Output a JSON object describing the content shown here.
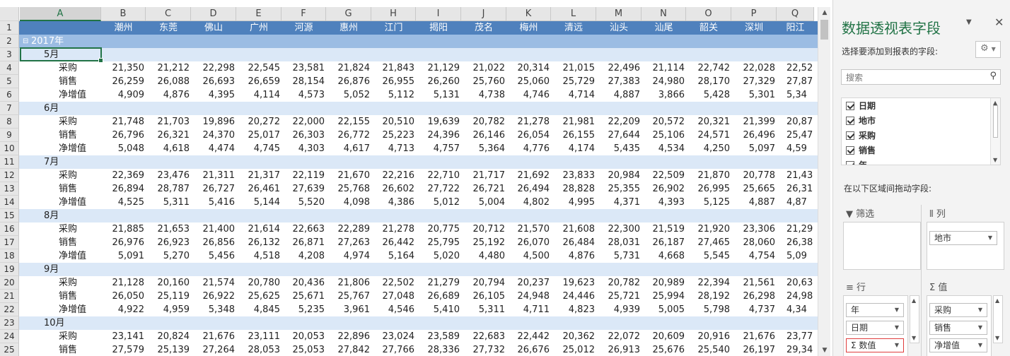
{
  "column_headers": [
    "A",
    "B",
    "C",
    "D",
    "E",
    "F",
    "G",
    "H",
    "I",
    "J",
    "K",
    "L",
    "M",
    "N",
    "O",
    "P",
    "Q"
  ],
  "row_numbers": [
    "1",
    "2",
    "3",
    "4",
    "5",
    "6",
    "7",
    "8",
    "9",
    "10",
    "11",
    "12",
    "13",
    "14",
    "15",
    "16",
    "17",
    "18",
    "19",
    "20",
    "21",
    "22",
    "23",
    "24",
    "25"
  ],
  "cities": [
    "潮州",
    "东莞",
    "佛山",
    "广州",
    "河源",
    "惠州",
    "江门",
    "揭阳",
    "茂名",
    "梅州",
    "清远",
    "汕头",
    "汕尾",
    "韶关",
    "深圳",
    "阳江"
  ],
  "year_label": "2017年",
  "year_toggle": "⊟",
  "blocks": [
    {
      "month": "5月",
      "rows": [
        {
          "label": "采购",
          "values": [
            "21,350",
            "21,212",
            "22,298",
            "22,545",
            "23,581",
            "21,824",
            "21,843",
            "21,129",
            "21,022",
            "20,314",
            "21,015",
            "22,496",
            "21,114",
            "22,742",
            "22,028",
            "22,52"
          ]
        },
        {
          "label": "销售",
          "values": [
            "26,259",
            "26,088",
            "26,693",
            "26,659",
            "28,154",
            "26,876",
            "26,955",
            "26,260",
            "25,760",
            "25,060",
            "25,729",
            "27,383",
            "24,980",
            "28,170",
            "27,329",
            "27,87"
          ]
        },
        {
          "label": "净增值",
          "values": [
            "4,909",
            "4,876",
            "4,395",
            "4,114",
            "4,573",
            "5,052",
            "5,112",
            "5,131",
            "4,738",
            "4,746",
            "4,714",
            "4,887",
            "3,866",
            "5,428",
            "5,301",
            "5,34"
          ]
        }
      ]
    },
    {
      "month": "6月",
      "rows": [
        {
          "label": "采购",
          "values": [
            "21,748",
            "21,703",
            "19,896",
            "20,272",
            "22,000",
            "22,155",
            "20,510",
            "19,639",
            "20,782",
            "21,278",
            "21,981",
            "22,209",
            "20,572",
            "20,321",
            "21,399",
            "20,87"
          ]
        },
        {
          "label": "销售",
          "values": [
            "26,796",
            "26,321",
            "24,370",
            "25,017",
            "26,303",
            "26,772",
            "25,223",
            "24,396",
            "26,146",
            "26,054",
            "26,155",
            "27,644",
            "25,106",
            "24,571",
            "26,496",
            "25,47"
          ]
        },
        {
          "label": "净增值",
          "values": [
            "5,048",
            "4,618",
            "4,474",
            "4,745",
            "4,303",
            "4,617",
            "4,713",
            "4,757",
            "5,364",
            "4,776",
            "4,174",
            "5,435",
            "4,534",
            "4,250",
            "5,097",
            "4,59"
          ]
        }
      ]
    },
    {
      "month": "7月",
      "rows": [
        {
          "label": "采购",
          "values": [
            "22,369",
            "23,476",
            "21,311",
            "21,317",
            "22,119",
            "21,670",
            "22,216",
            "22,710",
            "21,717",
            "21,692",
            "23,833",
            "20,984",
            "22,509",
            "21,870",
            "20,778",
            "21,43"
          ]
        },
        {
          "label": "销售",
          "values": [
            "26,894",
            "28,787",
            "26,727",
            "26,461",
            "27,639",
            "25,768",
            "26,602",
            "27,722",
            "26,721",
            "26,494",
            "28,828",
            "25,355",
            "26,902",
            "26,995",
            "25,665",
            "26,31"
          ]
        },
        {
          "label": "净增值",
          "values": [
            "4,525",
            "5,311",
            "5,416",
            "5,144",
            "5,520",
            "4,098",
            "4,386",
            "5,012",
            "5,004",
            "4,802",
            "4,995",
            "4,371",
            "4,393",
            "5,125",
            "4,887",
            "4,87"
          ]
        }
      ]
    },
    {
      "month": "8月",
      "rows": [
        {
          "label": "采购",
          "values": [
            "21,885",
            "21,653",
            "21,400",
            "21,614",
            "22,663",
            "22,289",
            "21,278",
            "20,775",
            "20,712",
            "21,570",
            "21,608",
            "22,300",
            "21,519",
            "21,920",
            "23,306",
            "21,29"
          ]
        },
        {
          "label": "销售",
          "values": [
            "26,976",
            "26,923",
            "26,856",
            "26,132",
            "26,871",
            "27,263",
            "26,442",
            "25,795",
            "25,192",
            "26,070",
            "26,484",
            "28,031",
            "26,187",
            "27,465",
            "28,060",
            "26,38"
          ]
        },
        {
          "label": "净增值",
          "values": [
            "5,091",
            "5,270",
            "5,456",
            "4,518",
            "4,208",
            "4,974",
            "5,164",
            "5,020",
            "4,480",
            "4,500",
            "4,876",
            "5,731",
            "4,668",
            "5,545",
            "4,754",
            "5,09"
          ]
        }
      ]
    },
    {
      "month": "9月",
      "rows": [
        {
          "label": "采购",
          "values": [
            "21,128",
            "20,160",
            "21,574",
            "20,780",
            "20,436",
            "21,806",
            "22,502",
            "21,279",
            "20,794",
            "20,237",
            "19,623",
            "20,782",
            "20,989",
            "22,394",
            "21,561",
            "20,63"
          ]
        },
        {
          "label": "销售",
          "values": [
            "26,050",
            "25,119",
            "26,922",
            "25,625",
            "25,671",
            "25,767",
            "27,048",
            "26,689",
            "26,105",
            "24,948",
            "24,446",
            "25,721",
            "25,994",
            "28,192",
            "26,298",
            "24,98"
          ]
        },
        {
          "label": "净增值",
          "values": [
            "4,922",
            "4,959",
            "5,348",
            "4,845",
            "5,235",
            "3,961",
            "4,546",
            "5,410",
            "5,311",
            "4,711",
            "4,823",
            "4,939",
            "5,005",
            "5,798",
            "4,737",
            "4,34"
          ]
        }
      ]
    },
    {
      "month": "10月",
      "rows": [
        {
          "label": "采购",
          "values": [
            "23,141",
            "20,824",
            "21,676",
            "23,111",
            "20,053",
            "22,896",
            "23,024",
            "23,589",
            "22,683",
            "22,442",
            "20,362",
            "22,072",
            "20,609",
            "20,916",
            "21,676",
            "23,77"
          ]
        },
        {
          "label": "销售",
          "values": [
            "27,579",
            "25,139",
            "27,264",
            "28,053",
            "25,053",
            "27,842",
            "27,766",
            "28,336",
            "27,732",
            "26,676",
            "25,012",
            "26,913",
            "25,676",
            "25,540",
            "26,197",
            "29,34"
          ]
        }
      ]
    }
  ],
  "panel": {
    "title": "数据透视表字段",
    "choose_label": "选择要添加到报表的字段:",
    "search_placeholder": "搜索",
    "fields": [
      "日期",
      "地市",
      "采购",
      "销售",
      "年"
    ],
    "drag_label": "在以下区域间拖动字段:",
    "filter_label": "筛选",
    "columns_label": "列",
    "rows_label": "行",
    "values_label": "值",
    "columns_items": [
      "地市"
    ],
    "rows_items": [
      "年",
      "日期",
      "Σ 数值"
    ],
    "values_items": [
      "采购",
      "销售",
      "净增值"
    ]
  },
  "colors": {
    "accent": "#217346",
    "city_header": "#4f81bd",
    "year_row": "#9bbce3",
    "month_row": "#dbe8f7",
    "highlight_border": "#e03c3c"
  }
}
